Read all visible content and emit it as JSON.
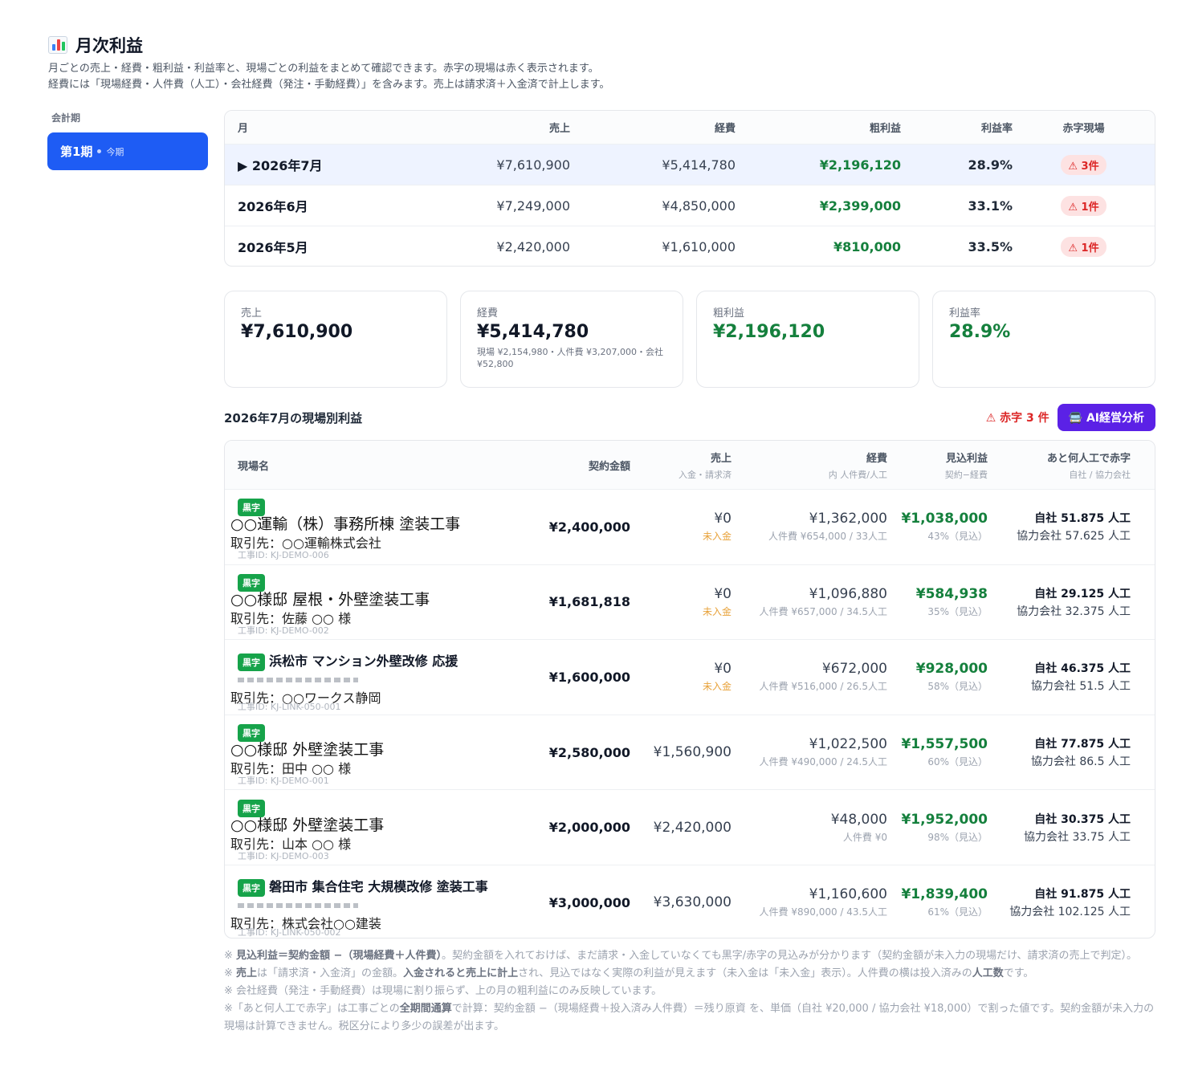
{
  "header": {
    "title": "月次利益",
    "desc1": "月ごとの売上・経費・粗利益・利益率と、現場ごとの利益をまとめて確認できます。赤字の現場は赤く表示されます。",
    "desc2": "経費には「現場経費・人件費（人工）・会社経費（発注・手動経費）」を含みます。売上は請求済＋入金済で計上します。"
  },
  "sidebar": {
    "label": "会計期",
    "period": "第1期",
    "period_sub": "今期"
  },
  "months": {
    "headers": [
      "月",
      "売上",
      "経費",
      "粗利益",
      "利益率",
      "赤字現場"
    ],
    "rows": [
      {
        "month": "▶ 2026年7月",
        "sales": "¥7,610,900",
        "expense": "¥5,414,780",
        "profit": "¥2,196,120",
        "rate": "28.9%",
        "deficit": "⚠ 3件"
      },
      {
        "month": "2026年6月",
        "sales": "¥7,249,000",
        "expense": "¥4,850,000",
        "profit": "¥2,399,000",
        "rate": "33.1%",
        "deficit": "⚠ 1件"
      },
      {
        "month": "2026年5月",
        "sales": "¥2,420,000",
        "expense": "¥1,610,000",
        "profit": "¥810,000",
        "rate": "33.5%",
        "deficit": "⚠ 1件"
      }
    ]
  },
  "cards": {
    "sales": {
      "label": "売上",
      "value": "¥7,610,900"
    },
    "expense": {
      "label": "経費",
      "value": "¥5,414,780",
      "note": "現場 ¥2,154,980・人件費 ¥3,207,000・会社 ¥52,800"
    },
    "profit": {
      "label": "粗利益",
      "value": "¥2,196,120"
    },
    "rate": {
      "label": "利益率",
      "value": "28.9%"
    }
  },
  "section": {
    "title": "2026年7月の現場別利益",
    "red_count": "⚠ 赤字 3 件",
    "ai_button": "🚍 AI経営分析"
  },
  "sites": {
    "headers": {
      "name": "現場名",
      "contract": "契約金額",
      "sales": "売上",
      "sales_sub": "入金・請求済",
      "expense": "経費",
      "expense_sub": "内 人件費/人工",
      "profit": "見込利益",
      "profit_sub": "契約−経費",
      "labor": "あと何人工で赤字",
      "labor_sub": "自社 / 協力会社"
    },
    "tag": "黒字",
    "rows": [
      {
        "title": "○○運輸（株）事務所棟 塗装工事",
        "client": "取引先：○○運輸株式会社",
        "id": "工事ID: KJ-DEMO-006",
        "contract": "¥2,400,000",
        "sales": "¥0",
        "sales_note": "未入金",
        "expense": "¥1,362,000",
        "expense_note": "人件費 ¥654,000 / 33人工",
        "profit": "¥1,038,000",
        "profit_note": "43%（見込）",
        "own": "自社 51.875 人工",
        "partner": "協力会社 57.625 人工"
      },
      {
        "title": "○○様邸 屋根・外壁塗装工事",
        "client": "取引先：佐藤 ○○ 様",
        "id": "工事ID: KJ-DEMO-002",
        "contract": "¥1,681,818",
        "sales": "¥0",
        "sales_note": "未入金",
        "expense": "¥1,096,880",
        "expense_note": "人件費 ¥657,000 / 34.5人工",
        "profit": "¥584,938",
        "profit_note": "35%（見込）",
        "own": "自社 29.125 人工",
        "partner": "協力会社 32.375 人工"
      },
      {
        "title": "浜松市 マンション外壁改修 応援",
        "client": "取引先：○○ワークス静岡",
        "id": "工事ID: KJ-LINK-050-001",
        "contract": "¥1,600,000",
        "sales": "¥0",
        "sales_note": "未入金",
        "expense": "¥672,000",
        "expense_note": "人件費 ¥516,000 / 26.5人工",
        "profit": "¥928,000",
        "profit_note": "58%（見込）",
        "own": "自社 46.375 人工",
        "partner": "協力会社 51.5 人工"
      },
      {
        "title": "○○様邸 外壁塗装工事",
        "client": "取引先：田中 ○○ 様",
        "id": "工事ID: KJ-DEMO-001",
        "contract": "¥2,580,000",
        "sales": "¥1,560,900",
        "sales_note": "",
        "expense": "¥1,022,500",
        "expense_note": "人件費 ¥490,000 / 24.5人工",
        "profit": "¥1,557,500",
        "profit_note": "60%（見込）",
        "own": "自社 77.875 人工",
        "partner": "協力会社 86.5 人工"
      },
      {
        "title": "○○様邸 外壁塗装工事",
        "client": "取引先：山本 ○○ 様",
        "id": "工事ID: KJ-DEMO-003",
        "contract": "¥2,000,000",
        "sales": "¥2,420,000",
        "sales_note": "",
        "expense": "¥48,000",
        "expense_note": "人件費 ¥0",
        "profit": "¥1,952,000",
        "profit_note": "98%（見込）",
        "own": "自社 30.375 人工",
        "partner": "協力会社 33.75 人工"
      },
      {
        "title": "磐田市 集合住宅 大規模改修 塗装工事",
        "client": "取引先：株式会社○○建装",
        "id": "工事ID: KJ-LINK-050-002",
        "contract": "¥3,000,000",
        "sales": "¥3,630,000",
        "sales_note": "",
        "expense": "¥1,160,600",
        "expense_note": "人件費 ¥890,000 / 43.5人工",
        "profit": "¥1,839,400",
        "profit_note": "61%（見込）",
        "own": "自社 91.875 人工",
        "partner": "協力会社 102.125 人工"
      }
    ]
  },
  "notes": {
    "n1a": "※ ",
    "n1b": "見込利益＝契約金額 −（現場経費＋人件費）",
    "n1c": "。契約金額を入れておけば、まだ請求・入金していなくても黒字/赤字の見込みが分かります（契約金額が未入力の現場だけ、請求済の売上で判定）。",
    "n2a": "※ ",
    "n2b": "売上",
    "n2c": "は「請求済・入金済」の金額。",
    "n2d": "入金されると売上に計上",
    "n2e": "され、見込ではなく実際の利益が見えます（未入金は「未入金」表示）。人件費の横は投入済みの",
    "n2f": "人工数",
    "n2g": "です。",
    "n3": "※ 会社経費（発注・手動経費）は現場に割り振らず、上の月の粗利益にのみ反映しています。",
    "n4a": "※「あと何人工で赤字」は工事ごとの",
    "n4b": "全期間通算",
    "n4c": "で計算：契約金額 −（現場経費＋投入済み人件費）＝残り原資 を、単価（自社 ¥20,000 / 協力会社 ¥18,000）で割った値です。契約金額が未入力の現場は計算できません。税区分により多少の誤差が出ます。"
  }
}
